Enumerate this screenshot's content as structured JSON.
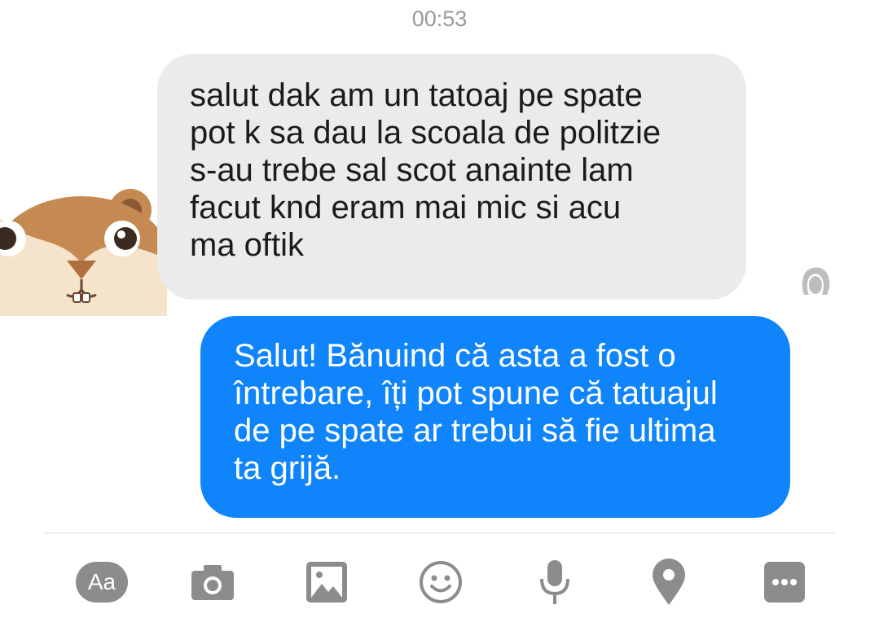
{
  "chat": {
    "timestamp": "00:53",
    "incoming_message": "salut dak am un tatoaj pe spate\npot k sa dau la scoala de politzie\ns-au trebe sal scot anainte lam\nfacut knd eram mai mic si acu\nma oftik",
    "outgoing_message": "Salut! Bănuind că asta a fost o\nîntrebare, îți pot spune că tatuajul\nde pe spate ar trebui să fie ultima\nta grijă."
  },
  "composer": {
    "text_button_label": "Aa",
    "icons": [
      "text-format-icon",
      "camera-icon",
      "gallery-icon",
      "emoji-icon",
      "microphone-icon",
      "location-icon",
      "more-icon"
    ]
  },
  "colors": {
    "incoming_bubble": "#ebebeb",
    "outgoing_bubble": "#0f84fb",
    "icon_gray": "#8c8c8c"
  }
}
